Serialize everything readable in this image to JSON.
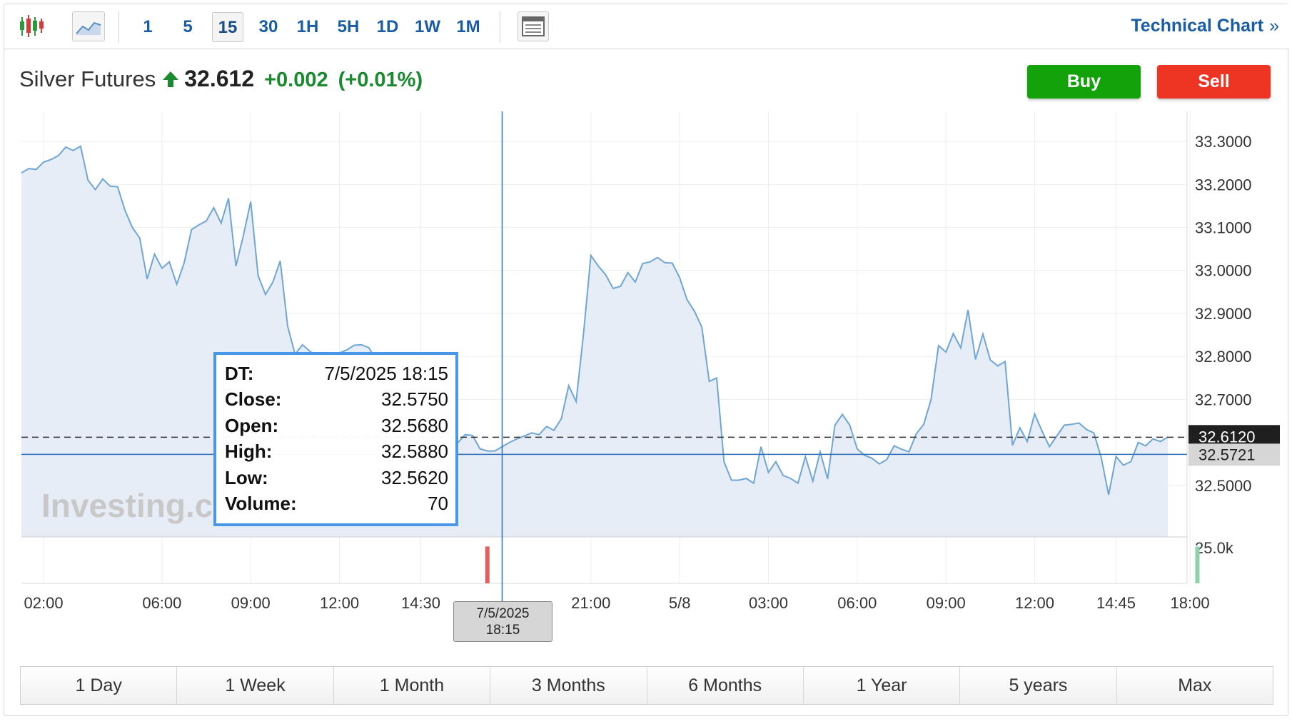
{
  "toolbar": {
    "intervals": [
      "1",
      "5",
      "15",
      "30",
      "1H",
      "5H",
      "1D",
      "1W",
      "1M"
    ],
    "active_interval": "15",
    "technical_chart_label": "Technical Chart",
    "technical_chart_chevron": "»",
    "icons": [
      "candlestick-icon",
      "area-chart-icon",
      "table-icon"
    ]
  },
  "quote": {
    "name": "Silver Futures",
    "price": "32.612",
    "change": "+0.002",
    "change_pct": "(+0.01%)",
    "direction": "up"
  },
  "actions": {
    "buy_label": "Buy",
    "sell_label": "Sell"
  },
  "tooltip": {
    "rows": [
      {
        "key": "DT:",
        "value": "7/5/2025 18:15"
      },
      {
        "key": "Close:",
        "value": "32.5750"
      },
      {
        "key": "Open:",
        "value": "32.5680"
      },
      {
        "key": "High:",
        "value": "32.5880"
      },
      {
        "key": "Low:",
        "value": "32.5620"
      },
      {
        "key": "Volume:",
        "value": "70"
      }
    ]
  },
  "crosshair": {
    "x_label_line1": "7/5/2025",
    "x_label_line2": "18:15",
    "y_label": "32.5721"
  },
  "watermark": "Investing.com",
  "ranges": [
    "1 Day",
    "1 Week",
    "1 Month",
    "3 Months",
    "6 Months",
    "1 Year",
    "5 years",
    "Max"
  ],
  "colors": {
    "line": "#6fa6d4",
    "fill": "#e6edf6",
    "up": "#1a8a2e",
    "buy": "#14a20b",
    "sell": "#ee3524",
    "accent": "#1a5da3",
    "volume_up": "#8fd1a8",
    "volume_down": "#e06060"
  },
  "chart_data": {
    "type": "area",
    "title": "Silver Futures",
    "y_axis": {
      "ticks": [
        "33.3000",
        "33.2000",
        "33.1000",
        "33.0000",
        "32.9000",
        "32.8000",
        "32.7000",
        "32.5000"
      ],
      "tick_values": [
        33.3,
        33.2,
        33.1,
        33.0,
        32.9,
        32.8,
        32.7,
        32.5
      ],
      "range": [
        32.38,
        33.37
      ],
      "last_price_label": "32.6120",
      "last_price": 32.612
    },
    "x_axis": {
      "ticks": [
        "02:00",
        "06:00",
        "09:00",
        "12:00",
        "14:30",
        "21:00",
        "5/8",
        "03:00",
        "06:00",
        "09:00",
        "12:00",
        "14:45",
        "18:00"
      ],
      "tick_index": [
        3,
        19,
        31,
        43,
        54,
        77,
        89,
        101,
        113,
        125,
        137,
        148,
        158
      ]
    },
    "volume_axis": {
      "ticks": [
        "25.0k"
      ],
      "tick_values": [
        25000
      ]
    },
    "x_index": [
      0,
      1,
      2,
      3,
      4,
      5,
      6,
      7,
      8,
      9,
      10,
      11,
      12,
      13,
      14,
      15,
      16,
      17,
      18,
      19,
      20,
      21,
      22,
      23,
      24,
      25,
      26,
      27,
      28,
      29,
      30,
      31,
      32,
      33,
      34,
      35,
      36,
      37,
      38,
      39,
      40,
      41,
      42,
      43,
      44,
      45,
      46,
      47,
      48,
      49,
      50,
      51,
      52,
      53,
      54,
      55,
      56,
      57,
      58,
      59,
      60,
      61,
      62,
      63,
      64,
      65,
      66,
      67,
      68,
      69,
      70,
      71,
      72,
      73,
      74,
      75,
      76,
      77,
      78,
      79,
      80,
      81,
      82,
      83,
      84,
      85,
      86,
      87,
      88,
      89,
      90,
      91,
      92,
      93,
      94,
      95,
      96,
      97,
      98,
      99,
      100,
      101,
      102,
      103,
      104,
      105,
      106,
      107,
      108,
      109,
      110,
      111,
      112,
      113,
      114,
      115,
      116,
      117,
      118,
      119,
      120,
      121,
      122,
      123,
      124,
      125,
      126,
      127,
      128,
      129,
      130,
      131,
      132,
      133,
      134,
      135,
      136,
      137,
      138,
      139,
      140,
      141,
      142,
      143,
      144,
      145,
      146,
      147,
      148,
      149,
      150,
      151,
      152,
      153,
      154,
      155,
      156,
      157,
      158,
      159,
      160
    ],
    "close": [
      33.227,
      33.237,
      33.235,
      33.252,
      33.258,
      33.267,
      33.287,
      33.279,
      33.289,
      33.21,
      33.188,
      33.213,
      33.196,
      33.195,
      33.14,
      33.1,
      33.075,
      32.98,
      33.038,
      33.005,
      33.02,
      32.968,
      33.017,
      33.095,
      33.106,
      33.115,
      33.146,
      33.11,
      33.168,
      33.01,
      33.08,
      33.16,
      32.988,
      32.944,
      32.973,
      33.022,
      32.87,
      32.805,
      32.827,
      32.812,
      32.8,
      32.808,
      32.795,
      32.808,
      32.815,
      32.826,
      32.827,
      32.82,
      32.79,
      32.775,
      32.77,
      32.76,
      32.775,
      32.76,
      32.75,
      32.68,
      32.64,
      32.6,
      32.596,
      32.599,
      32.618,
      32.616,
      32.585,
      32.58,
      32.58,
      32.59,
      32.6,
      32.608,
      32.615,
      32.622,
      32.618,
      32.637,
      32.628,
      32.655,
      32.732,
      32.695,
      32.853,
      33.035,
      33.01,
      32.99,
      32.958,
      32.963,
      32.995,
      32.973,
      33.016,
      33.02,
      33.03,
      33.018,
      33.017,
      32.983,
      32.932,
      32.905,
      32.868,
      32.742,
      32.75,
      32.555,
      32.512,
      32.512,
      32.516,
      32.505,
      32.59,
      32.53,
      32.555,
      32.523,
      32.516,
      32.505,
      32.567,
      32.51,
      32.578,
      32.515,
      32.64,
      32.665,
      32.64,
      32.585,
      32.57,
      32.563,
      32.55,
      32.56,
      32.592,
      32.584,
      32.578,
      32.62,
      32.642,
      32.7,
      32.825,
      32.81,
      32.853,
      32.82,
      32.908,
      32.793,
      32.852,
      32.792,
      32.778,
      32.788,
      32.593,
      32.634,
      32.602,
      32.666,
      32.626,
      32.59,
      32.615,
      32.64,
      32.642,
      32.645,
      32.63,
      32.622,
      32.565,
      32.478,
      32.567,
      32.547,
      32.555,
      32.6,
      32.592,
      32.608,
      32.602,
      32.612
    ],
    "volume": [
      0,
      0,
      0,
      0,
      0,
      0,
      0,
      0,
      0,
      0,
      0,
      0,
      0,
      0,
      0,
      0,
      0,
      0,
      0,
      0,
      0,
      0,
      0,
      0,
      0,
      0,
      0,
      0,
      0,
      0,
      0,
      0,
      0,
      0,
      0,
      0,
      0,
      0,
      0,
      0,
      0,
      0,
      0,
      0,
      0,
      0,
      0,
      0,
      0,
      0,
      0,
      0,
      0,
      0,
      0,
      0,
      0,
      0,
      0,
      0,
      0,
      0,
      0,
      0,
      0,
      0,
      0,
      0,
      0,
      0,
      0,
      0,
      0,
      0,
      0,
      0,
      0,
      0,
      0,
      0,
      0,
      0,
      0,
      0,
      0,
      0,
      0,
      0,
      0,
      0,
      0,
      0,
      0,
      0,
      0,
      0,
      0,
      0,
      0,
      0,
      0,
      0,
      0,
      0,
      0,
      0,
      0,
      0,
      0,
      0,
      0,
      0,
      0,
      0,
      0,
      0,
      0,
      0,
      0,
      0,
      0,
      0,
      0,
      0,
      0,
      0,
      0,
      0,
      0,
      0,
      0,
      0,
      0,
      0,
      0,
      0,
      0,
      0,
      0,
      0,
      0,
      0,
      0,
      0,
      0,
      0,
      0,
      0,
      0,
      0,
      0,
      0,
      0,
      0,
      0,
      0,
      0,
      0,
      0,
      0,
      0
    ],
    "volume_spikes": [
      {
        "x_index": 63,
        "volume": 25800,
        "direction": "down"
      },
      {
        "x_index": 159,
        "volume": 25800,
        "direction": "up"
      }
    ],
    "crosshair_x_index": 65,
    "crosshair_y_value": 32.5721,
    "grid": true
  }
}
